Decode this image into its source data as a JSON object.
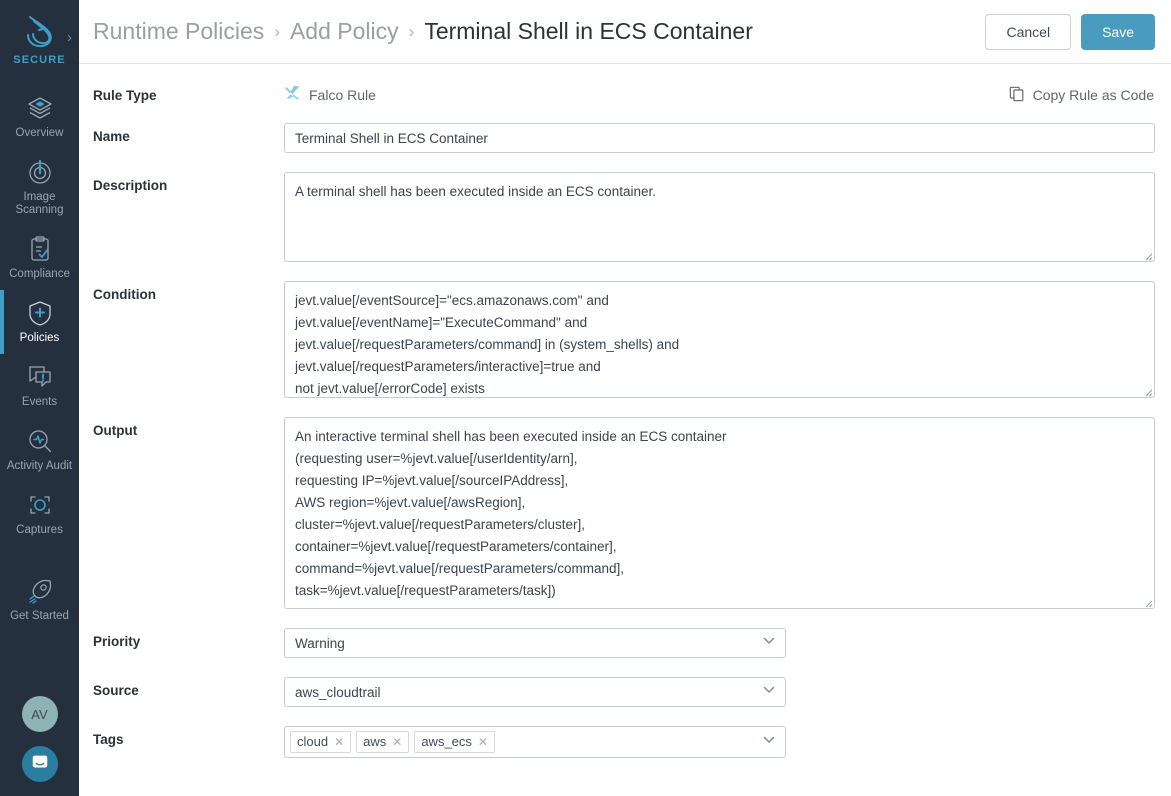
{
  "sidebar": {
    "brand": {
      "text": "SECURE",
      "logo_icon": "sysdig-logo-icon",
      "expand_icon": "chevron-right-icon"
    },
    "items": [
      {
        "label": "Overview",
        "icon": "layers-icon",
        "active": false
      },
      {
        "label": "Image Scanning",
        "icon": "scan-target-icon",
        "active": false
      },
      {
        "label": "Compliance",
        "icon": "clipboard-check-icon",
        "active": false
      },
      {
        "label": "Policies",
        "icon": "shield-plus-icon",
        "active": true
      },
      {
        "label": "Events",
        "icon": "alert-bubble-icon",
        "active": false
      },
      {
        "label": "Activity Audit",
        "icon": "magnifier-pulse-icon",
        "active": false
      },
      {
        "label": "Captures",
        "icon": "capture-frame-icon",
        "active": false
      },
      {
        "label": "Get Started",
        "icon": "rocket-icon",
        "active": false
      }
    ],
    "avatar": {
      "initials": "AV"
    },
    "chat": {
      "icon": "chat-bubble-icon"
    }
  },
  "header": {
    "breadcrumb": [
      "Runtime Policies",
      "Add Policy",
      "Terminal Shell in ECS Container"
    ],
    "separator": "›",
    "cancel_label": "Cancel",
    "save_label": "Save"
  },
  "form": {
    "rule_type": {
      "label": "Rule Type",
      "value": "Falco Rule",
      "icon": "falco-icon"
    },
    "copy_rule": {
      "label": "Copy Rule as Code",
      "icon": "copy-icon"
    },
    "name": {
      "label": "Name",
      "value": "Terminal Shell in ECS Container",
      "placeholder": "Name"
    },
    "description": {
      "label": "Description",
      "value": "A terminal shell has been executed inside an ECS container.",
      "placeholder": "Description"
    },
    "condition": {
      "label": "Condition",
      "value": "jevt.value[/eventSource]=\"ecs.amazonaws.com\" and\njevt.value[/eventName]=\"ExecuteCommand\" and\njevt.value[/requestParameters/command] in (system_shells) and\njevt.value[/requestParameters/interactive]=true and\nnot jevt.value[/errorCode] exists",
      "placeholder": "Condition"
    },
    "output": {
      "label": "Output",
      "value": "An interactive terminal shell has been executed inside an ECS container\n(requesting user=%jevt.value[/userIdentity/arn],\nrequesting IP=%jevt.value[/sourceIPAddress],\nAWS region=%jevt.value[/awsRegion],\ncluster=%jevt.value[/requestParameters/cluster],\ncontainer=%jevt.value[/requestParameters/container],\ncommand=%jevt.value[/requestParameters/command],\ntask=%jevt.value[/requestParameters/task])",
      "placeholder": "Output"
    },
    "priority": {
      "label": "Priority",
      "value": "Warning"
    },
    "source": {
      "label": "Source",
      "value": "aws_cloudtrail"
    },
    "tags": {
      "label": "Tags",
      "values": [
        "cloud",
        "aws",
        "aws_ecs"
      ],
      "remove_icon": "close-icon"
    }
  },
  "colors": {
    "sidebar_bg": "#25303f",
    "accent": "#3f9fc4",
    "save_button": "#4a9cbf",
    "chat_button": "#2a7fa0",
    "avatar_bg": "#8fb3b3",
    "border": "#c3ccd4"
  }
}
